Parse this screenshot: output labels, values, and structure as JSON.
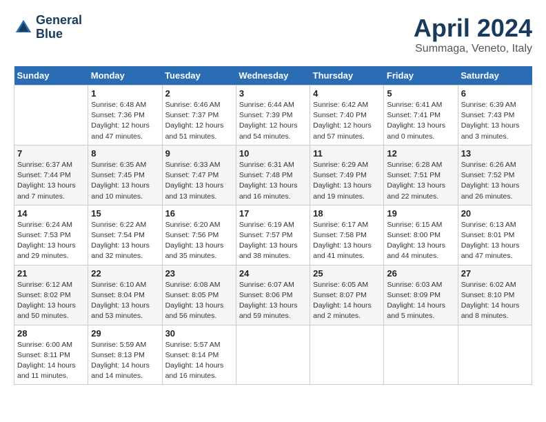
{
  "header": {
    "logo_line1": "General",
    "logo_line2": "Blue",
    "month_title": "April 2024",
    "location": "Summaga, Veneto, Italy"
  },
  "weekdays": [
    "Sunday",
    "Monday",
    "Tuesday",
    "Wednesday",
    "Thursday",
    "Friday",
    "Saturday"
  ],
  "weeks": [
    [
      {
        "day": "",
        "info": ""
      },
      {
        "day": "1",
        "info": "Sunrise: 6:48 AM\nSunset: 7:36 PM\nDaylight: 12 hours\nand 47 minutes."
      },
      {
        "day": "2",
        "info": "Sunrise: 6:46 AM\nSunset: 7:37 PM\nDaylight: 12 hours\nand 51 minutes."
      },
      {
        "day": "3",
        "info": "Sunrise: 6:44 AM\nSunset: 7:39 PM\nDaylight: 12 hours\nand 54 minutes."
      },
      {
        "day": "4",
        "info": "Sunrise: 6:42 AM\nSunset: 7:40 PM\nDaylight: 12 hours\nand 57 minutes."
      },
      {
        "day": "5",
        "info": "Sunrise: 6:41 AM\nSunset: 7:41 PM\nDaylight: 13 hours\nand 0 minutes."
      },
      {
        "day": "6",
        "info": "Sunrise: 6:39 AM\nSunset: 7:43 PM\nDaylight: 13 hours\nand 3 minutes."
      }
    ],
    [
      {
        "day": "7",
        "info": "Sunrise: 6:37 AM\nSunset: 7:44 PM\nDaylight: 13 hours\nand 7 minutes."
      },
      {
        "day": "8",
        "info": "Sunrise: 6:35 AM\nSunset: 7:45 PM\nDaylight: 13 hours\nand 10 minutes."
      },
      {
        "day": "9",
        "info": "Sunrise: 6:33 AM\nSunset: 7:47 PM\nDaylight: 13 hours\nand 13 minutes."
      },
      {
        "day": "10",
        "info": "Sunrise: 6:31 AM\nSunset: 7:48 PM\nDaylight: 13 hours\nand 16 minutes."
      },
      {
        "day": "11",
        "info": "Sunrise: 6:29 AM\nSunset: 7:49 PM\nDaylight: 13 hours\nand 19 minutes."
      },
      {
        "day": "12",
        "info": "Sunrise: 6:28 AM\nSunset: 7:51 PM\nDaylight: 13 hours\nand 22 minutes."
      },
      {
        "day": "13",
        "info": "Sunrise: 6:26 AM\nSunset: 7:52 PM\nDaylight: 13 hours\nand 26 minutes."
      }
    ],
    [
      {
        "day": "14",
        "info": "Sunrise: 6:24 AM\nSunset: 7:53 PM\nDaylight: 13 hours\nand 29 minutes."
      },
      {
        "day": "15",
        "info": "Sunrise: 6:22 AM\nSunset: 7:54 PM\nDaylight: 13 hours\nand 32 minutes."
      },
      {
        "day": "16",
        "info": "Sunrise: 6:20 AM\nSunset: 7:56 PM\nDaylight: 13 hours\nand 35 minutes."
      },
      {
        "day": "17",
        "info": "Sunrise: 6:19 AM\nSunset: 7:57 PM\nDaylight: 13 hours\nand 38 minutes."
      },
      {
        "day": "18",
        "info": "Sunrise: 6:17 AM\nSunset: 7:58 PM\nDaylight: 13 hours\nand 41 minutes."
      },
      {
        "day": "19",
        "info": "Sunrise: 6:15 AM\nSunset: 8:00 PM\nDaylight: 13 hours\nand 44 minutes."
      },
      {
        "day": "20",
        "info": "Sunrise: 6:13 AM\nSunset: 8:01 PM\nDaylight: 13 hours\nand 47 minutes."
      }
    ],
    [
      {
        "day": "21",
        "info": "Sunrise: 6:12 AM\nSunset: 8:02 PM\nDaylight: 13 hours\nand 50 minutes."
      },
      {
        "day": "22",
        "info": "Sunrise: 6:10 AM\nSunset: 8:04 PM\nDaylight: 13 hours\nand 53 minutes."
      },
      {
        "day": "23",
        "info": "Sunrise: 6:08 AM\nSunset: 8:05 PM\nDaylight: 13 hours\nand 56 minutes."
      },
      {
        "day": "24",
        "info": "Sunrise: 6:07 AM\nSunset: 8:06 PM\nDaylight: 13 hours\nand 59 minutes."
      },
      {
        "day": "25",
        "info": "Sunrise: 6:05 AM\nSunset: 8:07 PM\nDaylight: 14 hours\nand 2 minutes."
      },
      {
        "day": "26",
        "info": "Sunrise: 6:03 AM\nSunset: 8:09 PM\nDaylight: 14 hours\nand 5 minutes."
      },
      {
        "day": "27",
        "info": "Sunrise: 6:02 AM\nSunset: 8:10 PM\nDaylight: 14 hours\nand 8 minutes."
      }
    ],
    [
      {
        "day": "28",
        "info": "Sunrise: 6:00 AM\nSunset: 8:11 PM\nDaylight: 14 hours\nand 11 minutes."
      },
      {
        "day": "29",
        "info": "Sunrise: 5:59 AM\nSunset: 8:13 PM\nDaylight: 14 hours\nand 14 minutes."
      },
      {
        "day": "30",
        "info": "Sunrise: 5:57 AM\nSunset: 8:14 PM\nDaylight: 14 hours\nand 16 minutes."
      },
      {
        "day": "",
        "info": ""
      },
      {
        "day": "",
        "info": ""
      },
      {
        "day": "",
        "info": ""
      },
      {
        "day": "",
        "info": ""
      }
    ]
  ]
}
